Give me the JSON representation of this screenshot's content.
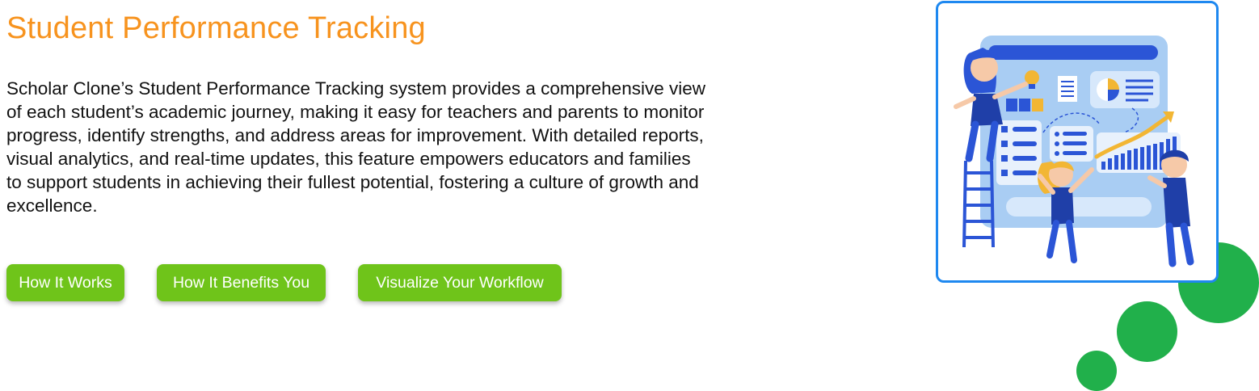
{
  "header": {
    "title": "Student Performance Tracking"
  },
  "main": {
    "description": "Scholar Clone’s Student Performance Tracking system provides a comprehensive view of each student’s academic journey, making it easy for teachers and parents to monitor progress, identify strengths, and address areas for improvement. With detailed reports, visual analytics, and real-time updates, this feature empowers educators and families to support students in achieving their fullest potential, fostering a culture of growth and excellence."
  },
  "buttons": [
    {
      "label": "How It Works"
    },
    {
      "label": "How It Benefits You"
    },
    {
      "label": "Visualize Your Workflow"
    }
  ],
  "colors": {
    "title": "#f7931e",
    "button": "#6fc41a",
    "accent_dots": "#21b04b",
    "illustration_border": "#1e88f0"
  },
  "illustration": {
    "icon": "student-performance-dashboard-illustration"
  }
}
